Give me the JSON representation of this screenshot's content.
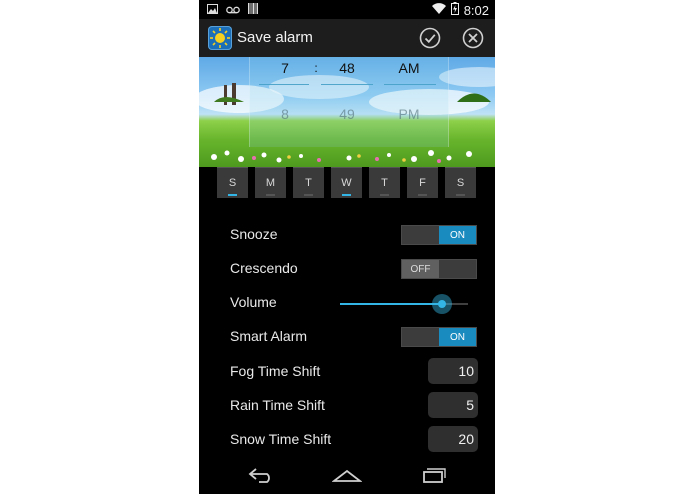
{
  "status_bar": {
    "time": "8:02",
    "left_icons": [
      "image-icon",
      "voicemail-icon",
      "barcode-icon"
    ],
    "right_icons": [
      "wifi-icon",
      "battery-icon"
    ]
  },
  "action_bar": {
    "title": "Save alarm",
    "icons": [
      "app-sun-icon",
      "check-icon",
      "close-icon"
    ]
  },
  "time_picker": {
    "hour": "7",
    "separator": ":",
    "minute": "48",
    "ampm": "AM",
    "next_hour": "8",
    "next_minute": "49",
    "next_ampm": "PM"
  },
  "days": [
    {
      "label": "S",
      "selected": true
    },
    {
      "label": "M",
      "selected": false
    },
    {
      "label": "T",
      "selected": false
    },
    {
      "label": "W",
      "selected": true
    },
    {
      "label": "T",
      "selected": false
    },
    {
      "label": "F",
      "selected": false
    },
    {
      "label": "S",
      "selected": false
    }
  ],
  "settings": {
    "snooze": {
      "label": "Snooze",
      "state": "ON"
    },
    "crescendo": {
      "label": "Crescendo",
      "state": "OFF"
    },
    "volume": {
      "label": "Volume",
      "level_fraction": 0.8
    },
    "smart_alarm": {
      "label": "Smart Alarm",
      "state": "ON"
    },
    "fog_time_shift": {
      "label": "Fog Time Shift",
      "value": "10"
    },
    "rain_time_shift": {
      "label": "Rain Time Shift",
      "value": "5"
    },
    "snow_time_shift": {
      "label": "Snow Time Shift",
      "value": "20"
    }
  },
  "navigation_bar": {
    "icons": [
      "back-icon",
      "home-icon",
      "recent-apps-icon"
    ]
  },
  "colors": {
    "accent": "#33b5e5",
    "toggle_on": "#1a8bbf",
    "background": "#000000",
    "action_bar": "#1d1d1d"
  }
}
